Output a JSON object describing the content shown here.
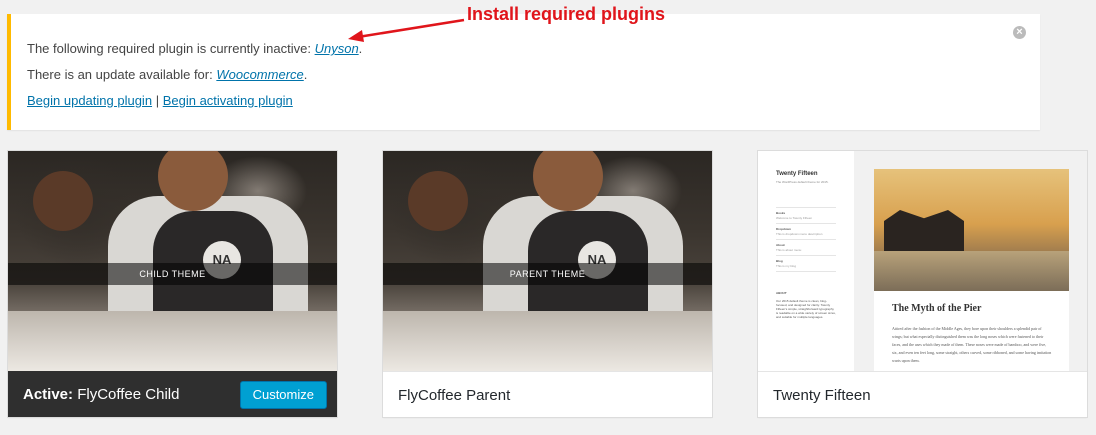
{
  "annotation": {
    "text": "Install required plugins",
    "color": "#e0151b"
  },
  "notice": {
    "line1_prefix": "The following required plugin is currently inactive: ",
    "line1_link": "Unyson",
    "line1_suffix": ".",
    "line2_prefix": "There is an update available for: ",
    "line2_link": "Woocommerce",
    "line2_suffix": ".",
    "action1": "Begin updating plugin",
    "separator": "|",
    "action2": "Begin activating plugin",
    "dismiss_icon": "dismiss-icon",
    "border_color": "#ffba00"
  },
  "themes": [
    {
      "active": true,
      "label_prefix": "Active:",
      "name": "FlyCoffee Child",
      "screenshot_caption": "CHILD THEME",
      "customize_label": "Customize",
      "logo_text": "NA"
    },
    {
      "active": false,
      "name": "FlyCoffee Parent",
      "screenshot_caption": "PARENT THEME",
      "logo_text": "NA"
    },
    {
      "active": false,
      "name": "Twenty Fifteen",
      "preview": {
        "site_title": "Twenty Fifteen",
        "site_desc": "The WordPress default theme for 2015.",
        "menu": [
          "Books",
          "Dropdown",
          "About",
          "Blog"
        ],
        "menu_notes": [
          "Welcome to Twenty Fifteen",
          "This is dropdown menu description",
          "This is about menu",
          "This is my blog"
        ],
        "about_heading": "ABOUT",
        "about_text": "Our 2015 default theme is clean, blog-focused, and designed for clarity. Twenty Fifteen's simple, straightforward typography is readable on a wide variety of screen sizes, and suitable for multiple languages.",
        "post_title": "The Myth of the Pier",
        "post_text": "Attired after the fashion of the Middle Ages, they bore upon their shoulders a splendid pair of wings; but what especially distinguished them was the long noses which were fastened to their faces, and the uses which they made of them. These noses were made of bamboo, and were five, six, and even ten feet long, some straight, others curved, some ribboned, and some having imitation warts upon them."
      }
    }
  ]
}
